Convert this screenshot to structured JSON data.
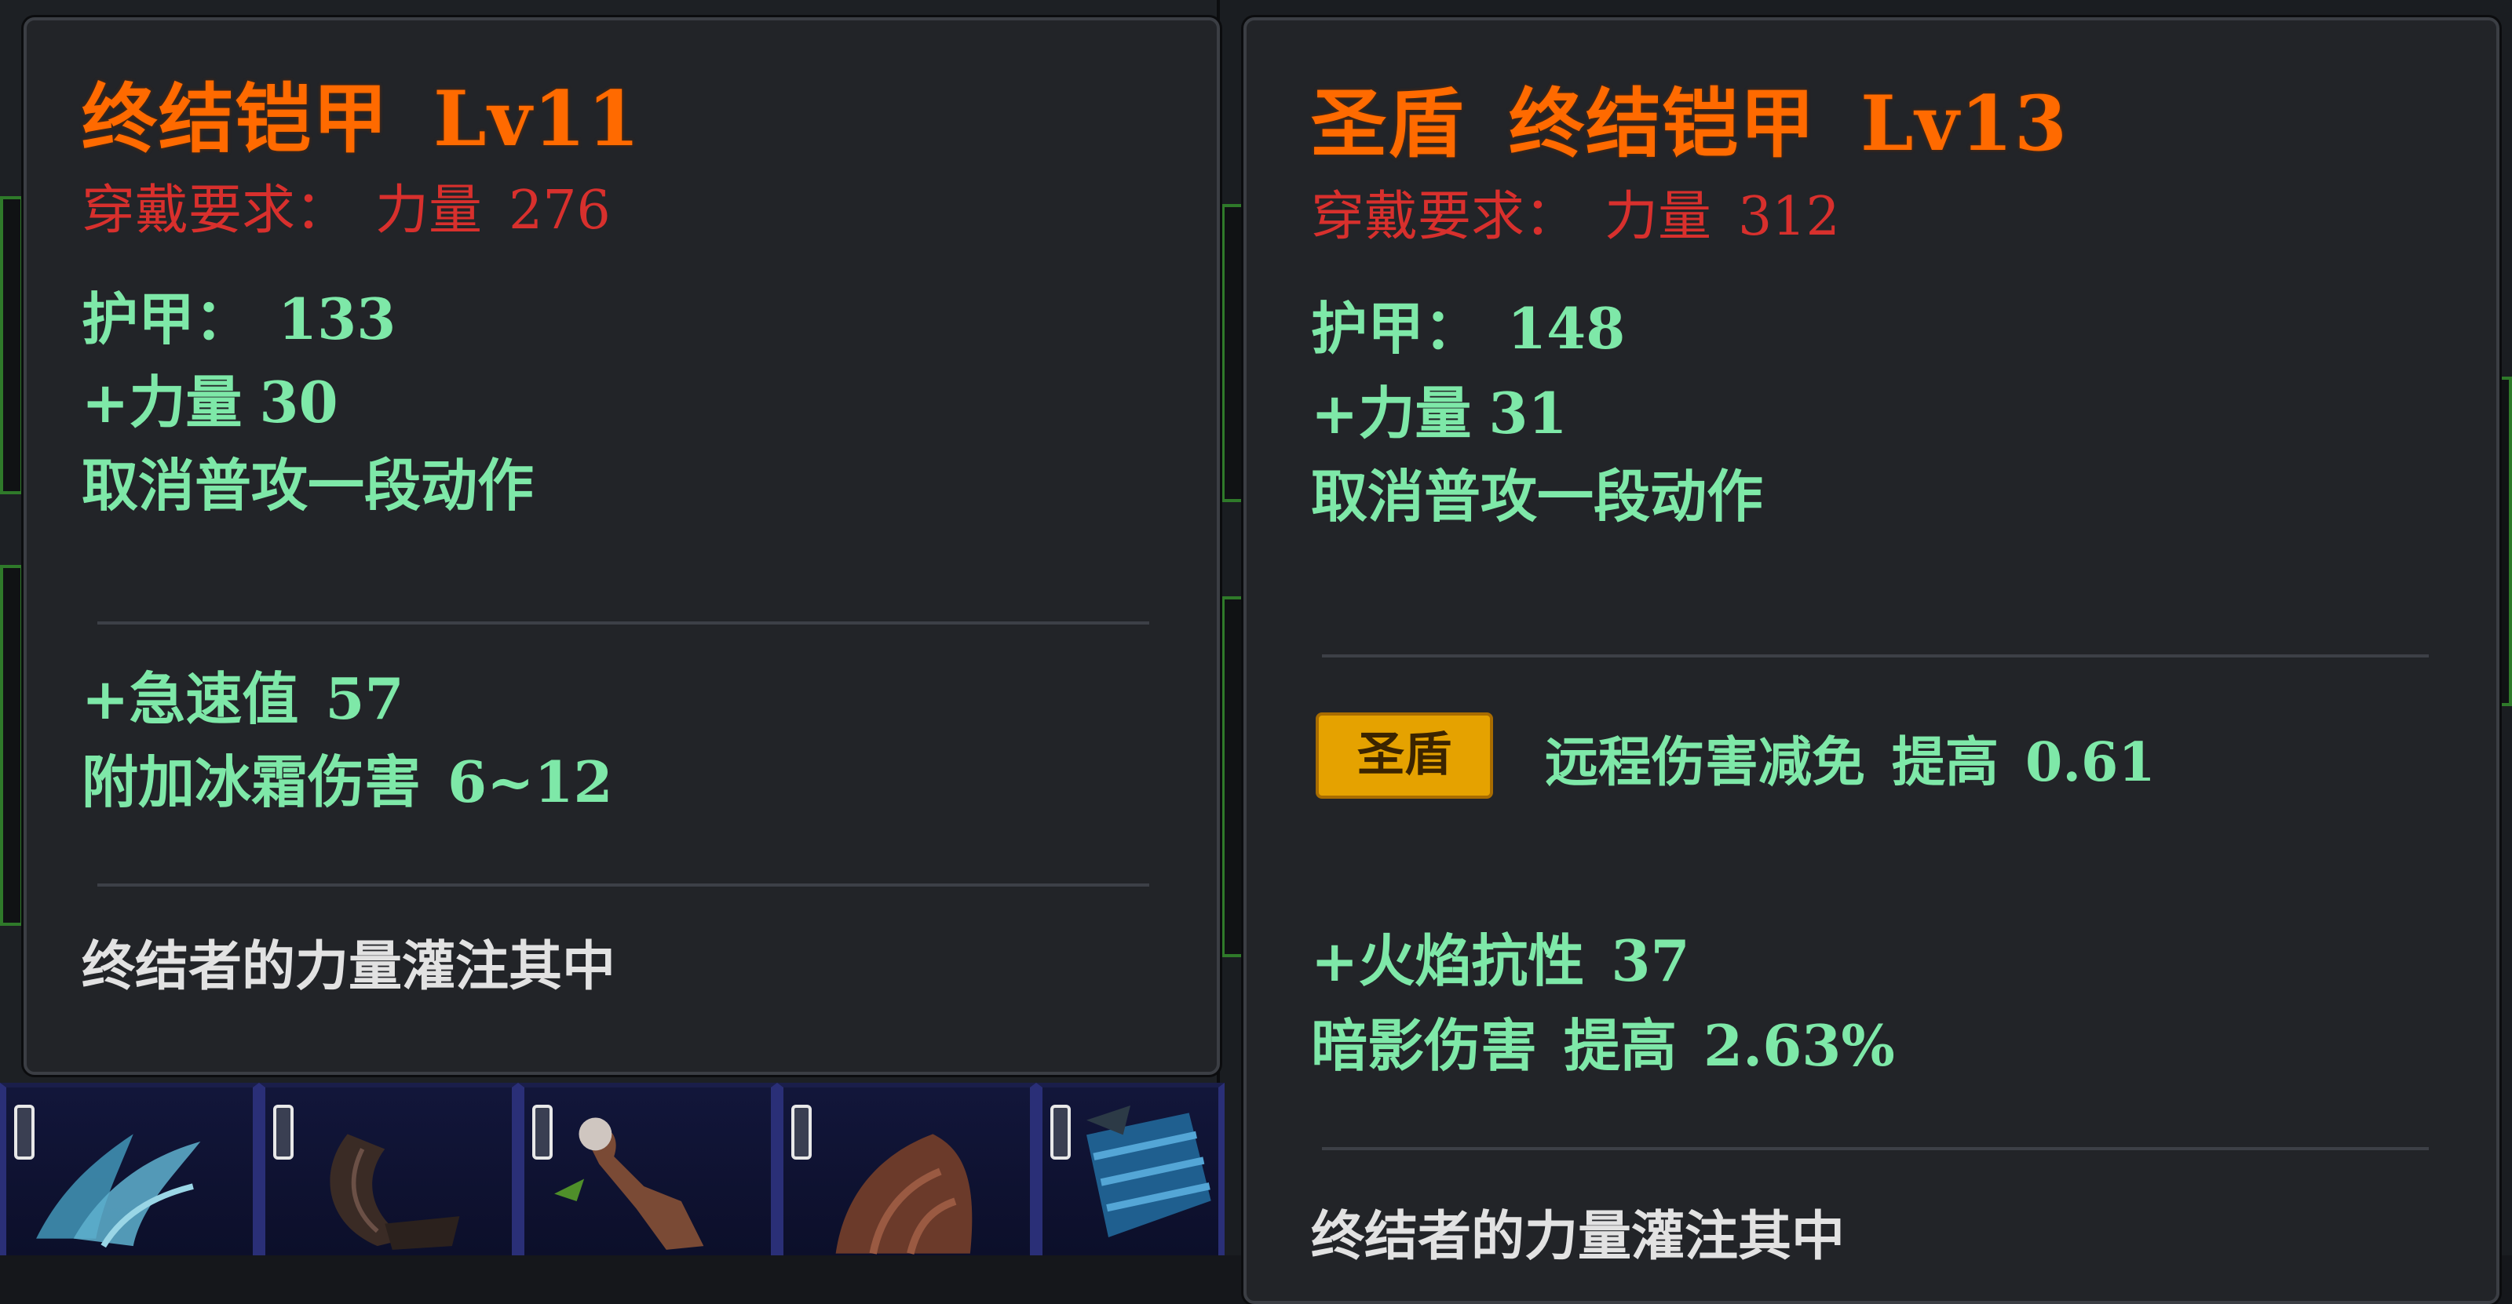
{
  "tooltips": [
    {
      "name": "终结铠甲",
      "level": "Lv11",
      "requirement_label": "穿戴要求：",
      "requirement_stat": "力量",
      "requirement_value": "276",
      "armor_label": "护甲：",
      "armor_value": "133",
      "stat_bonus_label": "+力量",
      "stat_bonus_value": "30",
      "special": "取消普攻一段动作",
      "extra_stats": [
        {
          "label": "+急速值",
          "value": "57"
        },
        {
          "label": "附加冰霜伤害",
          "value": "6~12"
        }
      ],
      "flavor": "终结者的力量灌注其中"
    },
    {
      "prefix": "圣盾",
      "name": "终结铠甲",
      "level": "Lv13",
      "requirement_label": "穿戴要求：",
      "requirement_stat": "力量",
      "requirement_value": "312",
      "armor_label": "护甲：",
      "armor_value": "148",
      "stat_bonus_label": "+力量",
      "stat_bonus_value": "31",
      "special": "取消普攻一段动作",
      "set_badge": "圣盾",
      "set_effect": "远程伤害减免",
      "set_effect_verb": "提高",
      "set_effect_value": "0.61",
      "extra_stats": [
        {
          "label": "+火焰抗性",
          "value": "37"
        },
        {
          "label": "暗影伤害",
          "verb": "提高",
          "value": "2.63%"
        }
      ],
      "flavor": "终结者的力量灌注其中"
    }
  ],
  "colors": {
    "title": "#ff6a00",
    "requirement": "#d8302d",
    "stat": "#7ee8a8",
    "flavor": "#e2e2e2",
    "badge": "#e5a200"
  },
  "icons": [
    "wing-item-icon",
    "horn-item-icon",
    "staff-item-icon",
    "claw-item-icon",
    "blue-armor-item-icon"
  ]
}
